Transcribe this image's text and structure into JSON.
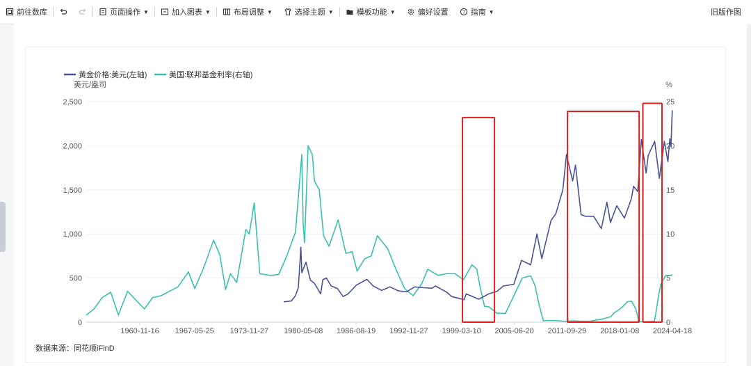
{
  "toolbar": {
    "items": [
      {
        "label": "前往数库",
        "icon": "database-icon"
      },
      {
        "label": "",
        "icon": "undo-icon"
      },
      {
        "label": "",
        "icon": "redo-icon"
      },
      {
        "label": "页面操作",
        "icon": "page-icon",
        "dropdown": true
      },
      {
        "label": "加入图表",
        "icon": "add-chart-icon",
        "dropdown": true
      },
      {
        "label": "布局调整",
        "icon": "layout-icon",
        "dropdown": true
      },
      {
        "label": "选择主题",
        "icon": "theme-icon",
        "dropdown": true
      },
      {
        "label": "模板功能",
        "icon": "folder-icon",
        "dropdown": true
      },
      {
        "label": "偏好设置",
        "icon": "gear-icon"
      },
      {
        "label": "指南",
        "icon": "help-icon",
        "dropdown": true
      }
    ],
    "right_label": "旧版作图"
  },
  "chart_data": {
    "type": "line",
    "legend": [
      "黄金价格:美元(左轴)",
      "美国:联邦基金利率(右轴)"
    ],
    "legend_position": "top-left",
    "left_unit": "美元/盎司",
    "right_unit": "%",
    "left_ylim": [
      0,
      2500
    ],
    "right_ylim": [
      0,
      25
    ],
    "left_ticks": [
      "0",
      "500",
      "1,000",
      "1,500",
      "2,000",
      "2,500"
    ],
    "right_ticks": [
      "0",
      "5",
      "10",
      "15",
      "20",
      "25"
    ],
    "x_ticks": [
      "1960-11-16",
      "1967-05-25",
      "1973-11-27",
      "1980-05-08",
      "1986-08-19",
      "1992-11-27",
      "1999-03-10",
      "2005-06-20",
      "2011-09-29",
      "2018-01-08",
      "2024-04-18"
    ],
    "x_range": [
      "1954-07-01",
      "2024-04-18"
    ],
    "source": "数据来源：同花顺iFinD",
    "colors": {
      "gold": "#4a5296",
      "rate": "#3cbfb0",
      "highlight": "#e0201c"
    },
    "grid": true,
    "series": [
      {
        "name": "黄金价格:美元(左轴)",
        "axis": "left",
        "color": "#4a5296",
        "points": [
          [
            "1978-01-01",
            230
          ],
          [
            "1978-12-01",
            240
          ],
          [
            "1979-06-01",
            300
          ],
          [
            "1979-10-01",
            390
          ],
          [
            "1980-01-21",
            850
          ],
          [
            "1980-03-01",
            560
          ],
          [
            "1980-09-01",
            680
          ],
          [
            "1981-03-01",
            480
          ],
          [
            "1981-09-01",
            440
          ],
          [
            "1982-06-01",
            320
          ],
          [
            "1982-09-01",
            480
          ],
          [
            "1983-02-01",
            500
          ],
          [
            "1983-09-01",
            410
          ],
          [
            "1984-06-01",
            380
          ],
          [
            "1985-02-01",
            290
          ],
          [
            "1985-09-01",
            320
          ],
          [
            "1986-09-01",
            420
          ],
          [
            "1987-12-01",
            485
          ],
          [
            "1988-09-01",
            410
          ],
          [
            "1989-09-01",
            360
          ],
          [
            "1990-09-01",
            400
          ],
          [
            "1991-09-01",
            355
          ],
          [
            "1992-09-01",
            345
          ],
          [
            "1993-08-01",
            400
          ],
          [
            "1994-09-01",
            390
          ],
          [
            "1995-09-01",
            385
          ],
          [
            "1996-02-01",
            410
          ],
          [
            "1997-06-01",
            340
          ],
          [
            "1998-01-01",
            290
          ],
          [
            "1999-07-01",
            255
          ],
          [
            "1999-10-01",
            320
          ],
          [
            "2001-04-01",
            260
          ],
          [
            "2002-06-01",
            320
          ],
          [
            "2003-06-01",
            350
          ],
          [
            "2004-03-01",
            410
          ],
          [
            "2005-06-01",
            430
          ],
          [
            "2006-05-01",
            700
          ],
          [
            "2007-06-01",
            650
          ],
          [
            "2008-03-01",
            1000
          ],
          [
            "2008-10-01",
            720
          ],
          [
            "2009-11-01",
            1150
          ],
          [
            "2010-06-01",
            1230
          ],
          [
            "2011-04-01",
            1500
          ],
          [
            "2011-09-06",
            1900
          ],
          [
            "2012-06-01",
            1600
          ],
          [
            "2012-10-01",
            1780
          ],
          [
            "2013-06-01",
            1220
          ],
          [
            "2013-12-01",
            1200
          ],
          [
            "2014-12-01",
            1200
          ],
          [
            "2015-11-01",
            1060
          ],
          [
            "2016-07-01",
            1360
          ],
          [
            "2016-12-01",
            1130
          ],
          [
            "2017-09-01",
            1320
          ],
          [
            "2018-08-01",
            1180
          ],
          [
            "2019-06-01",
            1400
          ],
          [
            "2019-09-01",
            1540
          ],
          [
            "2020-03-01",
            1480
          ],
          [
            "2020-08-06",
            2070
          ],
          [
            "2021-03-01",
            1690
          ],
          [
            "2021-06-01",
            1890
          ],
          [
            "2022-03-08",
            2050
          ],
          [
            "2022-09-28",
            1630
          ],
          [
            "2023-05-04",
            2050
          ],
          [
            "2023-10-05",
            1820
          ],
          [
            "2023-12-28",
            2080
          ],
          [
            "2024-02-14",
            1990
          ],
          [
            "2024-04-12",
            2400
          ]
        ]
      },
      {
        "name": "美国:联邦基金利率(右轴)",
        "axis": "right",
        "color": "#3cbfb0",
        "points": [
          [
            "1954-07-01",
            0.8
          ],
          [
            "1955-06-01",
            1.5
          ],
          [
            "1956-06-01",
            2.8
          ],
          [
            "1957-06-01",
            3.4
          ],
          [
            "1958-05-01",
            0.8
          ],
          [
            "1959-06-01",
            3.5
          ],
          [
            "1960-06-01",
            2.5
          ],
          [
            "1961-06-01",
            1.5
          ],
          [
            "1962-06-01",
            2.8
          ],
          [
            "1963-06-01",
            3.0
          ],
          [
            "1964-06-01",
            3.5
          ],
          [
            "1965-06-01",
            4.0
          ],
          [
            "1966-09-01",
            5.7
          ],
          [
            "1967-06-01",
            3.8
          ],
          [
            "1968-06-01",
            6.0
          ],
          [
            "1969-09-01",
            9.3
          ],
          [
            "1970-06-01",
            7.6
          ],
          [
            "1971-02-01",
            3.7
          ],
          [
            "1971-09-01",
            5.5
          ],
          [
            "1972-06-01",
            4.5
          ],
          [
            "1973-07-01",
            10.5
          ],
          [
            "1973-12-01",
            10.0
          ],
          [
            "1974-07-01",
            13.5
          ],
          [
            "1975-03-01",
            5.5
          ],
          [
            "1976-06-01",
            5.3
          ],
          [
            "1977-06-01",
            5.4
          ],
          [
            "1978-06-01",
            7.6
          ],
          [
            "1979-06-01",
            10.2
          ],
          [
            "1980-03-01",
            19.0
          ],
          [
            "1980-05-01",
            11.0
          ],
          [
            "1980-07-01",
            9.0
          ],
          [
            "1980-12-01",
            20.0
          ],
          [
            "1981-06-01",
            19.0
          ],
          [
            "1981-09-01",
            16.0
          ],
          [
            "1982-04-01",
            15.0
          ],
          [
            "1982-10-01",
            9.8
          ],
          [
            "1983-06-01",
            8.6
          ],
          [
            "1984-07-01",
            11.6
          ],
          [
            "1985-06-01",
            7.8
          ],
          [
            "1986-03-01",
            8.0
          ],
          [
            "1986-10-01",
            5.8
          ],
          [
            "1987-09-01",
            7.2
          ],
          [
            "1988-06-01",
            7.5
          ],
          [
            "1989-03-01",
            9.8
          ],
          [
            "1990-06-01",
            8.3
          ],
          [
            "1991-06-01",
            5.9
          ],
          [
            "1992-06-01",
            3.8
          ],
          [
            "1993-06-01",
            3.0
          ],
          [
            "1994-06-01",
            4.3
          ],
          [
            "1995-03-01",
            6.0
          ],
          [
            "1996-06-01",
            5.3
          ],
          [
            "1997-06-01",
            5.5
          ],
          [
            "1998-06-01",
            5.5
          ],
          [
            "1999-06-01",
            4.8
          ],
          [
            "2000-06-01",
            6.5
          ],
          [
            "2001-01-01",
            6.0
          ],
          [
            "2001-06-01",
            3.9
          ],
          [
            "2001-12-01",
            1.8
          ],
          [
            "2002-06-01",
            1.75
          ],
          [
            "2003-06-01",
            1.0
          ],
          [
            "2004-06-01",
            1.0
          ],
          [
            "2005-06-01",
            3.0
          ],
          [
            "2006-06-01",
            5.0
          ],
          [
            "2007-06-01",
            5.25
          ],
          [
            "2007-12-01",
            4.2
          ],
          [
            "2008-06-01",
            2.0
          ],
          [
            "2008-12-01",
            0.15
          ],
          [
            "2009-06-01",
            0.2
          ],
          [
            "2010-06-01",
            0.18
          ],
          [
            "2011-06-01",
            0.1
          ],
          [
            "2012-06-01",
            0.16
          ],
          [
            "2013-06-01",
            0.1
          ],
          [
            "2014-06-01",
            0.1
          ],
          [
            "2015-12-01",
            0.35
          ],
          [
            "2016-12-01",
            0.6
          ],
          [
            "2017-06-01",
            1.1
          ],
          [
            "2017-12-01",
            1.4
          ],
          [
            "2018-06-01",
            1.8
          ],
          [
            "2018-12-01",
            2.3
          ],
          [
            "2019-06-01",
            2.4
          ],
          [
            "2019-08-01",
            2.1
          ],
          [
            "2019-12-01",
            1.55
          ],
          [
            "2020-03-01",
            0.65
          ],
          [
            "2020-04-01",
            0.05
          ],
          [
            "2021-06-01",
            0.08
          ],
          [
            "2022-03-01",
            0.1
          ],
          [
            "2022-06-01",
            1.6
          ],
          [
            "2022-09-01",
            3.1
          ],
          [
            "2022-12-01",
            4.3
          ],
          [
            "2023-03-01",
            4.7
          ],
          [
            "2023-07-01",
            5.3
          ],
          [
            "2024-04-18",
            5.33
          ]
        ]
      }
    ],
    "highlights": [
      {
        "x_start": "1999-04-20",
        "x_end": "2003-02-10",
        "left_top": 2320
      },
      {
        "x_start": "2011-10-20",
        "x_end": "2020-05-01",
        "left_top": 2390
      },
      {
        "x_start": "2020-10-10",
        "x_end": "2023-01-20",
        "left_top": 2480
      }
    ]
  }
}
